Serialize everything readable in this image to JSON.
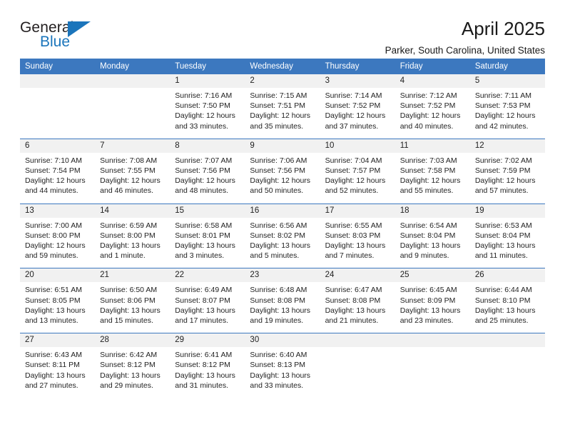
{
  "logo": {
    "word1": "General",
    "word2": "Blue",
    "triangle_color": "#1b75bb"
  },
  "header": {
    "title": "April 2025",
    "subtitle": "Parker, South Carolina, United States"
  },
  "theme": {
    "header_bg": "#3c78bf",
    "header_text": "#ffffff",
    "daynum_bg": "#f1f1f1",
    "rule_color": "#3c78bf",
    "body_text": "#222222"
  },
  "weekdays": [
    "Sunday",
    "Monday",
    "Tuesday",
    "Wednesday",
    "Thursday",
    "Friday",
    "Saturday"
  ],
  "weeks": [
    {
      "days": [
        {
          "num": "",
          "lines": ""
        },
        {
          "num": "",
          "lines": ""
        },
        {
          "num": "1",
          "lines": "Sunrise: 7:16 AM\nSunset: 7:50 PM\nDaylight: 12 hours and 33 minutes."
        },
        {
          "num": "2",
          "lines": "Sunrise: 7:15 AM\nSunset: 7:51 PM\nDaylight: 12 hours and 35 minutes."
        },
        {
          "num": "3",
          "lines": "Sunrise: 7:14 AM\nSunset: 7:52 PM\nDaylight: 12 hours and 37 minutes."
        },
        {
          "num": "4",
          "lines": "Sunrise: 7:12 AM\nSunset: 7:52 PM\nDaylight: 12 hours and 40 minutes."
        },
        {
          "num": "5",
          "lines": "Sunrise: 7:11 AM\nSunset: 7:53 PM\nDaylight: 12 hours and 42 minutes."
        }
      ]
    },
    {
      "days": [
        {
          "num": "6",
          "lines": "Sunrise: 7:10 AM\nSunset: 7:54 PM\nDaylight: 12 hours and 44 minutes."
        },
        {
          "num": "7",
          "lines": "Sunrise: 7:08 AM\nSunset: 7:55 PM\nDaylight: 12 hours and 46 minutes."
        },
        {
          "num": "8",
          "lines": "Sunrise: 7:07 AM\nSunset: 7:56 PM\nDaylight: 12 hours and 48 minutes."
        },
        {
          "num": "9",
          "lines": "Sunrise: 7:06 AM\nSunset: 7:56 PM\nDaylight: 12 hours and 50 minutes."
        },
        {
          "num": "10",
          "lines": "Sunrise: 7:04 AM\nSunset: 7:57 PM\nDaylight: 12 hours and 52 minutes."
        },
        {
          "num": "11",
          "lines": "Sunrise: 7:03 AM\nSunset: 7:58 PM\nDaylight: 12 hours and 55 minutes."
        },
        {
          "num": "12",
          "lines": "Sunrise: 7:02 AM\nSunset: 7:59 PM\nDaylight: 12 hours and 57 minutes."
        }
      ]
    },
    {
      "days": [
        {
          "num": "13",
          "lines": "Sunrise: 7:00 AM\nSunset: 8:00 PM\nDaylight: 12 hours and 59 minutes."
        },
        {
          "num": "14",
          "lines": "Sunrise: 6:59 AM\nSunset: 8:00 PM\nDaylight: 13 hours and 1 minute."
        },
        {
          "num": "15",
          "lines": "Sunrise: 6:58 AM\nSunset: 8:01 PM\nDaylight: 13 hours and 3 minutes."
        },
        {
          "num": "16",
          "lines": "Sunrise: 6:56 AM\nSunset: 8:02 PM\nDaylight: 13 hours and 5 minutes."
        },
        {
          "num": "17",
          "lines": "Sunrise: 6:55 AM\nSunset: 8:03 PM\nDaylight: 13 hours and 7 minutes."
        },
        {
          "num": "18",
          "lines": "Sunrise: 6:54 AM\nSunset: 8:04 PM\nDaylight: 13 hours and 9 minutes."
        },
        {
          "num": "19",
          "lines": "Sunrise: 6:53 AM\nSunset: 8:04 PM\nDaylight: 13 hours and 11 minutes."
        }
      ]
    },
    {
      "days": [
        {
          "num": "20",
          "lines": "Sunrise: 6:51 AM\nSunset: 8:05 PM\nDaylight: 13 hours and 13 minutes."
        },
        {
          "num": "21",
          "lines": "Sunrise: 6:50 AM\nSunset: 8:06 PM\nDaylight: 13 hours and 15 minutes."
        },
        {
          "num": "22",
          "lines": "Sunrise: 6:49 AM\nSunset: 8:07 PM\nDaylight: 13 hours and 17 minutes."
        },
        {
          "num": "23",
          "lines": "Sunrise: 6:48 AM\nSunset: 8:08 PM\nDaylight: 13 hours and 19 minutes."
        },
        {
          "num": "24",
          "lines": "Sunrise: 6:47 AM\nSunset: 8:08 PM\nDaylight: 13 hours and 21 minutes."
        },
        {
          "num": "25",
          "lines": "Sunrise: 6:45 AM\nSunset: 8:09 PM\nDaylight: 13 hours and 23 minutes."
        },
        {
          "num": "26",
          "lines": "Sunrise: 6:44 AM\nSunset: 8:10 PM\nDaylight: 13 hours and 25 minutes."
        }
      ]
    },
    {
      "days": [
        {
          "num": "27",
          "lines": "Sunrise: 6:43 AM\nSunset: 8:11 PM\nDaylight: 13 hours and 27 minutes."
        },
        {
          "num": "28",
          "lines": "Sunrise: 6:42 AM\nSunset: 8:12 PM\nDaylight: 13 hours and 29 minutes."
        },
        {
          "num": "29",
          "lines": "Sunrise: 6:41 AM\nSunset: 8:12 PM\nDaylight: 13 hours and 31 minutes."
        },
        {
          "num": "30",
          "lines": "Sunrise: 6:40 AM\nSunset: 8:13 PM\nDaylight: 13 hours and 33 minutes."
        },
        {
          "num": "",
          "lines": ""
        },
        {
          "num": "",
          "lines": ""
        },
        {
          "num": "",
          "lines": ""
        }
      ]
    }
  ]
}
